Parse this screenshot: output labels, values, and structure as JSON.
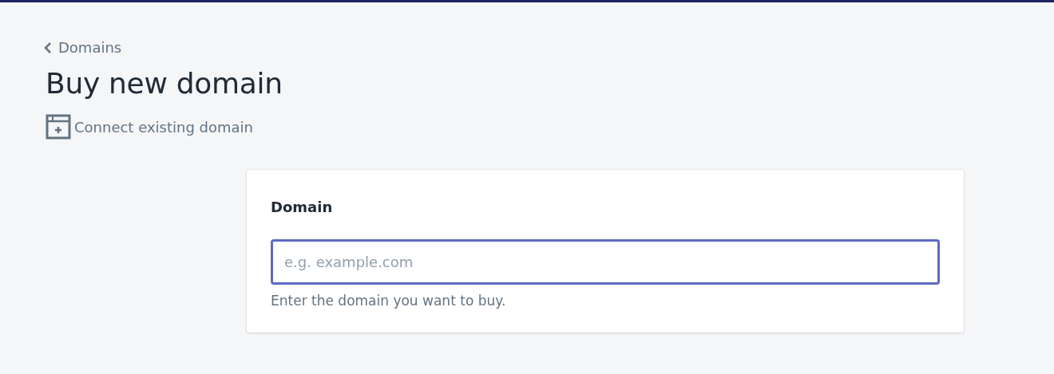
{
  "breadcrumb": {
    "label": "Domains"
  },
  "title": "Buy new domain",
  "secondary_action": {
    "label": "Connect existing domain"
  },
  "card": {
    "heading": "Domain",
    "field": {
      "placeholder": "e.g. example.com",
      "focused": true
    },
    "help_text": "Enter the domain you want to buy."
  }
}
